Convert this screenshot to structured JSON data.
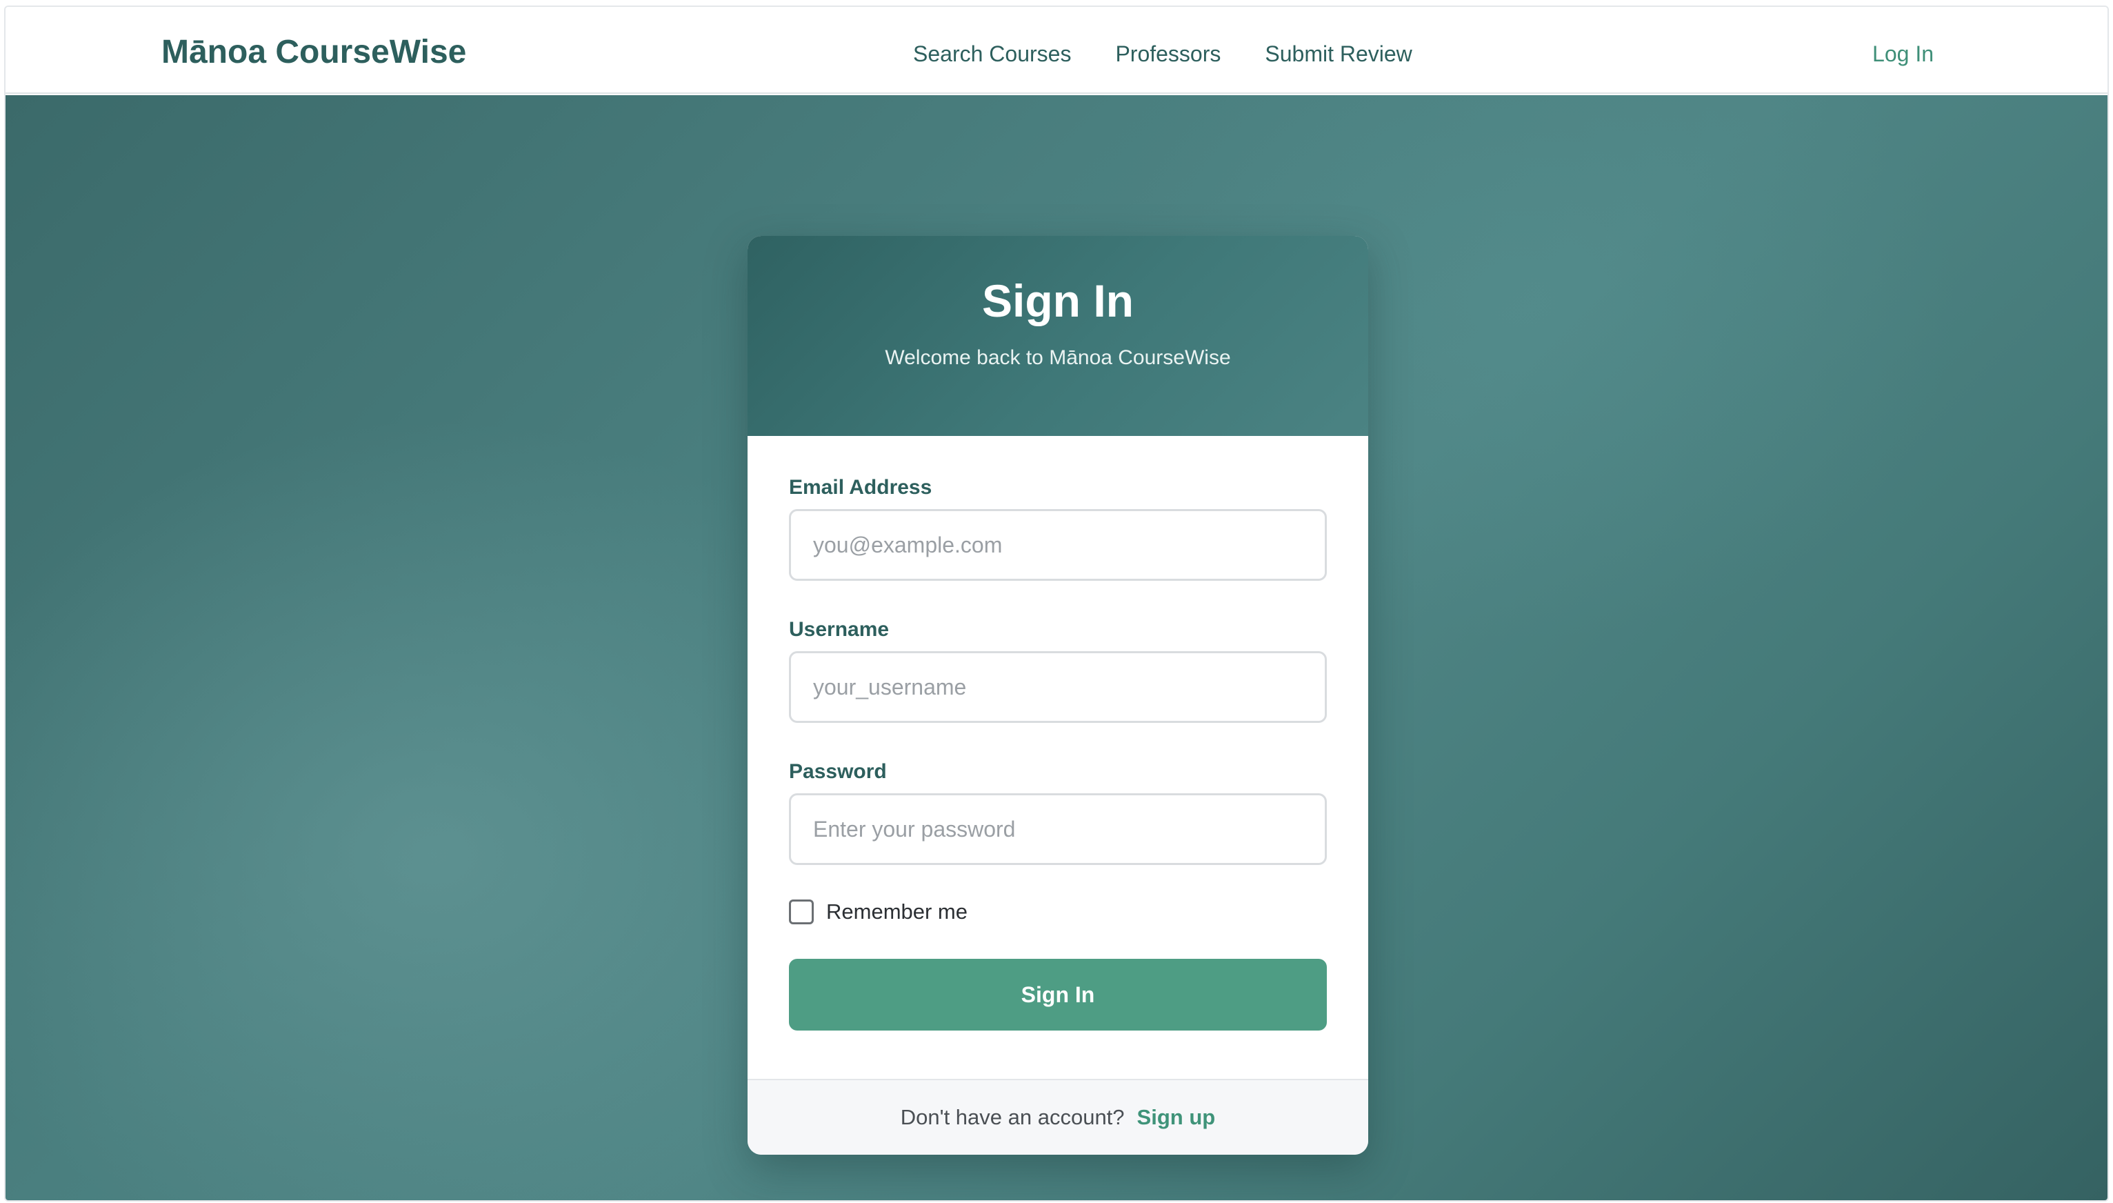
{
  "navbar": {
    "brand": "Mānoa CourseWise",
    "links": [
      "Search Courses",
      "Professors",
      "Submit Review"
    ],
    "login": "Log In"
  },
  "signin": {
    "title": "Sign In",
    "subtitle": "Welcome back to Mānoa CourseWise",
    "email": {
      "label": "Email Address",
      "placeholder": "you@example.com",
      "value": ""
    },
    "username": {
      "label": "Username",
      "placeholder": "your_username",
      "value": ""
    },
    "password": {
      "label": "Password",
      "placeholder": "Enter your password",
      "value": ""
    },
    "remember_label": "Remember me",
    "remember_checked": false,
    "submit_label": "Sign In",
    "footer_text": "Don't have an account?",
    "footer_link": "Sign up"
  },
  "colors": {
    "brand_text": "#2d5f5d",
    "accent_green": "#4e9d84",
    "link_green": "#3f9379",
    "background_teal": "#4a7f7f"
  }
}
